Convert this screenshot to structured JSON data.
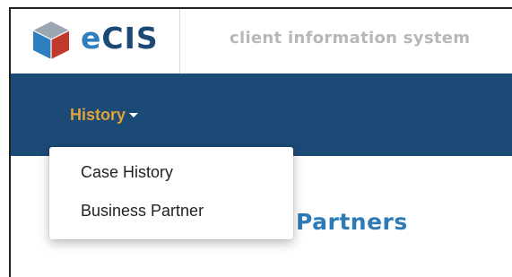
{
  "app": {
    "brand_prefix": "e",
    "brand_suffix": "CIS",
    "tagline": "client information system"
  },
  "colors": {
    "navbar_bg": "#1c4a76",
    "nav_text": "#e0a339",
    "brand_e": "#2d7fc0",
    "brand_cis": "#1c4a76",
    "page_title": "#2c7ab6"
  },
  "nav": {
    "history_label": "History",
    "history_caret_icon": "caret-down-icon"
  },
  "dropdown": {
    "items": [
      {
        "label": "Case History"
      },
      {
        "label": "Business Partner"
      }
    ]
  },
  "main": {
    "title_visible": "Partners"
  },
  "icons": {
    "logo": "cube-logo-icon"
  }
}
